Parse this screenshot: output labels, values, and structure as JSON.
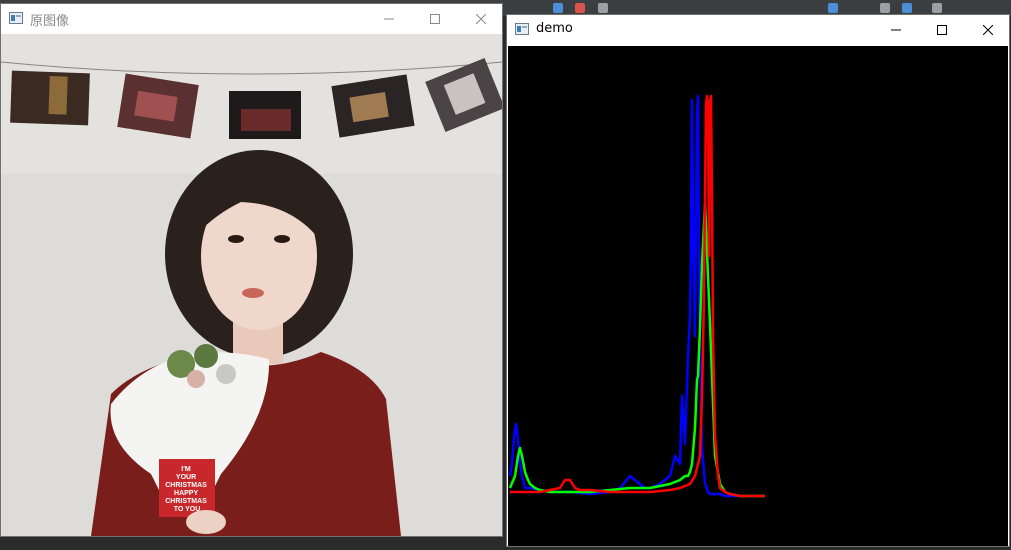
{
  "window_original": {
    "title": "原图像",
    "title_color": "#8a8a8a",
    "image_caption": [
      "I'M",
      "YOUR",
      "CHRISTMAS",
      "HAPPY",
      "CHRISTMAS",
      "TO YOU"
    ]
  },
  "window_demo": {
    "title": "demo",
    "title_color": "#000000"
  },
  "colors": {
    "background": "#2b2b2b",
    "plot_background": "#000000",
    "blue_channel": "#0000ff",
    "green_channel": "#00ff00",
    "red_channel": "#ff0000"
  },
  "chart_data": {
    "type": "line",
    "title": "",
    "xlabel": "",
    "ylabel": "",
    "xlim": [
      0,
      255
    ],
    "ylim": [
      0,
      100
    ],
    "grid": false,
    "legend": false,
    "series": [
      {
        "color": "#0000ff",
        "x": [
          0,
          2,
          4,
          6,
          8,
          10,
          12,
          15,
          20,
          40,
          60,
          80,
          100,
          110,
          120,
          130,
          135,
          140,
          150,
          160,
          165,
          170,
          172,
          175,
          177,
          178,
          180,
          181,
          182,
          183,
          184,
          185,
          186,
          187,
          188,
          189,
          190,
          192,
          195,
          198,
          200,
          205,
          210,
          215,
          220,
          230,
          240,
          255
        ],
        "y": [
          5,
          8,
          15,
          18,
          14,
          8,
          5,
          2,
          2,
          1,
          1,
          0.5,
          1,
          2,
          5,
          3,
          2,
          2,
          3,
          5,
          10,
          8,
          25,
          13,
          28,
          35,
          45,
          60,
          99,
          72,
          55,
          40,
          70,
          95,
          100,
          60,
          35,
          12,
          3,
          1,
          0.5,
          0.5,
          0.5,
          0,
          0,
          0,
          0,
          0
        ]
      },
      {
        "color": "#00ff00",
        "x": [
          0,
          5,
          8,
          10,
          12,
          15,
          18,
          20,
          25,
          30,
          40,
          60,
          80,
          100,
          120,
          140,
          160,
          170,
          175,
          178,
          180,
          182,
          185,
          187,
          188,
          190,
          192,
          195,
          200,
          205,
          210,
          215,
          220,
          230,
          255
        ],
        "y": [
          2,
          5,
          10,
          12,
          10,
          6,
          4,
          3,
          2,
          1.5,
          1,
          1,
          1,
          1.5,
          2,
          2,
          3,
          4,
          5,
          5,
          6,
          8,
          17,
          29,
          30,
          42,
          58,
          73,
          43,
          10,
          3,
          1,
          0.5,
          0,
          0
        ]
      },
      {
        "color": "#ff0000",
        "x": [
          0,
          10,
          20,
          30,
          40,
          50,
          55,
          60,
          65,
          70,
          80,
          100,
          120,
          140,
          160,
          170,
          180,
          185,
          190,
          192,
          194,
          195,
          196,
          197,
          198,
          199,
          200,
          201,
          202,
          203,
          205,
          208,
          210,
          215,
          220,
          230,
          255
        ],
        "y": [
          1,
          1,
          1,
          1,
          1.5,
          2,
          4,
          4,
          2,
          1.5,
          1.5,
          1,
          1,
          1,
          1.5,
          2,
          3,
          5,
          10,
          25,
          50,
          75,
          98,
          100,
          95,
          60,
          99,
          100,
          75,
          40,
          15,
          5,
          2,
          1,
          0.5,
          0,
          0
        ]
      }
    ]
  }
}
